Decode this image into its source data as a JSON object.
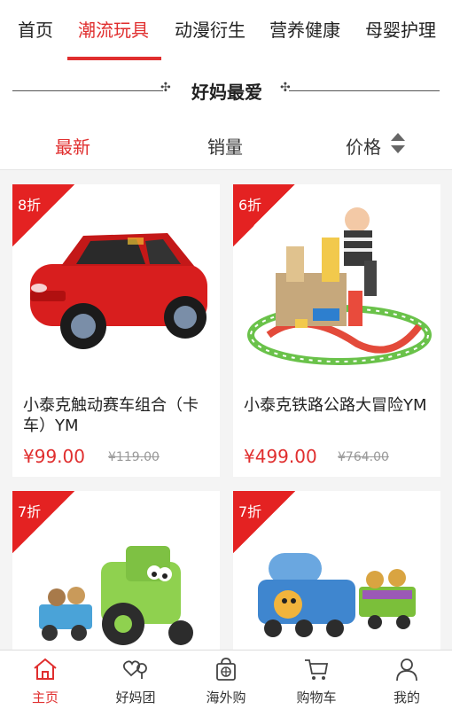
{
  "top_tabs": [
    "首页",
    "潮流玩具",
    "动漫衍生",
    "营养健康",
    "母婴护理"
  ],
  "section": {
    "title": "好妈最爱"
  },
  "sort": {
    "newest": "最新",
    "sales": "销量",
    "price": "价格"
  },
  "products": [
    {
      "discount": "8折",
      "name": "小泰克触动赛车组合（卡车）YM",
      "price": "¥99.00",
      "old_price": "¥119.00"
    },
    {
      "discount": "6折",
      "name": "小泰克铁路公路大冒险YM",
      "price": "¥499.00",
      "old_price": "¥764.00"
    },
    {
      "discount": "7折",
      "name": "",
      "price": "",
      "old_price": ""
    },
    {
      "discount": "7折",
      "name": "",
      "price": "",
      "old_price": ""
    }
  ],
  "bottom_nav": [
    "主页",
    "好妈团",
    "海外购",
    "购物车",
    "我的"
  ],
  "colors": {
    "accent": "#e02e2e",
    "badge": "#e42222"
  }
}
